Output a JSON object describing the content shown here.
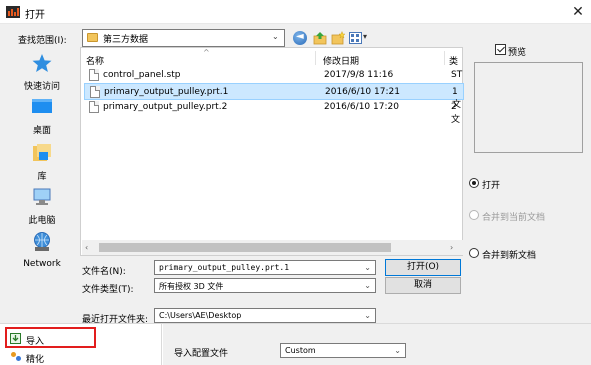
{
  "window": {
    "title": "打开",
    "close_glyph": "✕"
  },
  "look_in": {
    "label": "查找范围(I):",
    "value": "第三方数据",
    "arrow": "⌄"
  },
  "toolbar": {
    "back_glyph": "◄",
    "view_arrow": "▾"
  },
  "places": [
    {
      "label": "快速访问",
      "icon": "star-icon"
    },
    {
      "label": "桌面",
      "icon": "desktop-icon"
    },
    {
      "label": "库",
      "icon": "library-icon"
    },
    {
      "label": "此电脑",
      "icon": "computer-icon"
    },
    {
      "label": "Network",
      "icon": "network-icon"
    }
  ],
  "file_list": {
    "sort_glyph": "^",
    "columns": {
      "name": "名称",
      "date": "修改日期",
      "type": "类"
    },
    "rows": [
      {
        "name": "control_panel.stp",
        "date": "2017/9/8 11:16",
        "type": "ST",
        "selected": false
      },
      {
        "name": "primary_output_pulley.prt.1",
        "date": "2016/6/10 17:21",
        "type": "1 文",
        "selected": true
      },
      {
        "name": "primary_output_pulley.prt.2",
        "date": "2016/6/10 17:20",
        "type": "2 文",
        "selected": false
      }
    ],
    "scroll_left": "‹",
    "scroll_right": "›"
  },
  "preview": {
    "label": "预览",
    "checked": true
  },
  "open_options": [
    {
      "label": "打开",
      "selected": true,
      "disabled": false
    },
    {
      "label": "合并到当前文档",
      "selected": false,
      "disabled": true
    },
    {
      "label": "合并到新文档",
      "selected": false,
      "disabled": false
    }
  ],
  "filename": {
    "label": "文件名(N):",
    "value": "primary_output_pulley.prt.1",
    "open_button": "打开(O)"
  },
  "filetype": {
    "label": "文件类型(T):",
    "value": "所有授权 3D 文件",
    "cancel_button": "取消"
  },
  "recent": {
    "label": "最近打开文件夹:",
    "value": "C:\\Users\\AE\\Desktop"
  },
  "bottom": {
    "tree_items": [
      {
        "label": "导入",
        "icon": "import-icon"
      },
      {
        "label": "精化",
        "icon": "refine-icon"
      }
    ],
    "import_config_label": "导入配置文件",
    "import_config_value": "Custom"
  },
  "colors": {
    "selection": "#cce8ff",
    "highlight_box": "#e21d1d",
    "accent": "#0078d7"
  }
}
